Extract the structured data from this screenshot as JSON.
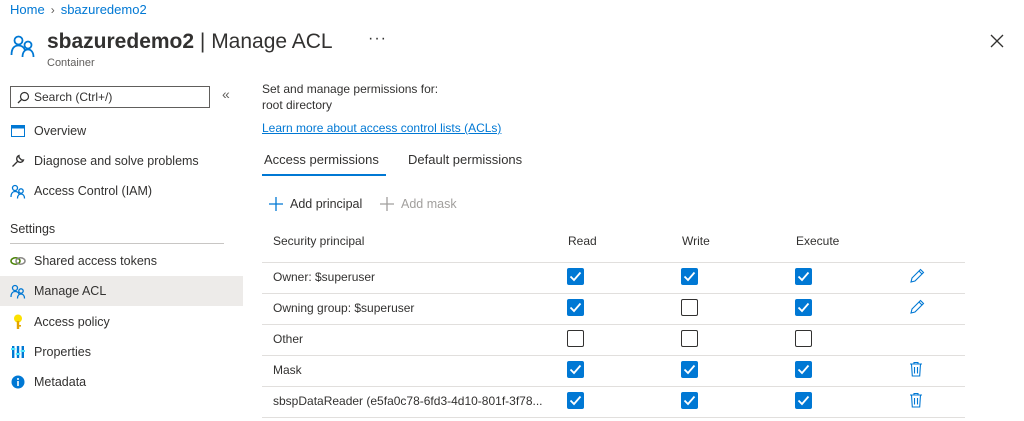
{
  "breadcrumb": {
    "home": "Home",
    "current": "sbazuredemo2"
  },
  "header": {
    "resource": "sbazuredemo2",
    "separator": " | ",
    "page": "Manage ACL",
    "more": "···",
    "subtitle": "Container"
  },
  "sidebar": {
    "search_placeholder": "Search (Ctrl+/)",
    "collapse": "«",
    "items": [
      {
        "label": "Overview",
        "icon": "overview-icon"
      },
      {
        "label": "Diagnose and solve problems",
        "icon": "wrench-icon"
      },
      {
        "label": "Access Control (IAM)",
        "icon": "people-icon"
      }
    ],
    "settings_heading": "Settings",
    "settings_items": [
      {
        "label": "Shared access tokens",
        "icon": "link-icon"
      },
      {
        "label": "Manage ACL",
        "icon": "people-icon",
        "active": true
      },
      {
        "label": "Access policy",
        "icon": "key-icon"
      },
      {
        "label": "Properties",
        "icon": "properties-icon"
      },
      {
        "label": "Metadata",
        "icon": "info-icon"
      }
    ]
  },
  "main": {
    "intro_line1": "Set and manage permissions for:",
    "intro_line2": "root directory",
    "learn_link": "Learn more about access control lists (ACLs)",
    "tabs": [
      {
        "label": "Access permissions",
        "active": true
      },
      {
        "label": "Default permissions",
        "active": false
      }
    ],
    "toolbar": {
      "add_principal": "Add principal",
      "add_mask": "Add mask"
    },
    "table": {
      "headers": [
        "Security principal",
        "Read",
        "Write",
        "Execute"
      ],
      "rows": [
        {
          "principal": "Owner: $superuser",
          "read": true,
          "write": true,
          "execute": true,
          "action": "edit"
        },
        {
          "principal": "Owning group: $superuser",
          "read": true,
          "write": false,
          "execute": true,
          "action": "edit"
        },
        {
          "principal": "Other",
          "read": false,
          "write": false,
          "execute": false,
          "action": ""
        },
        {
          "principal": "Mask",
          "read": true,
          "write": true,
          "execute": true,
          "action": "delete"
        },
        {
          "principal": "sbspDataReader (e5fa0c78-6fd3-4d10-801f-3f78...",
          "read": true,
          "write": true,
          "execute": true,
          "action": "delete"
        }
      ]
    }
  },
  "colors": {
    "accent": "#0078d4",
    "text": "#323130",
    "muted": "#605e5c"
  }
}
